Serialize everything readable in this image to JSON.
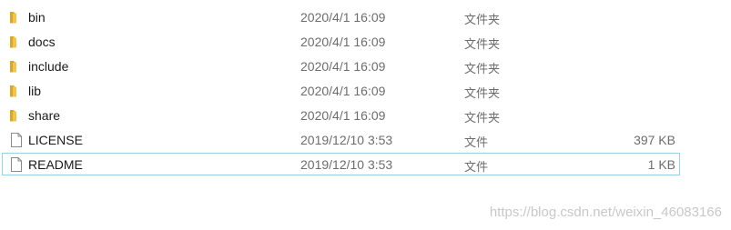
{
  "files": [
    {
      "name": "bin",
      "date": "2020/4/1 16:09",
      "type": "文件夹",
      "size": "",
      "icon": "folder-icon"
    },
    {
      "name": "docs",
      "date": "2020/4/1 16:09",
      "type": "文件夹",
      "size": "",
      "icon": "folder-icon"
    },
    {
      "name": "include",
      "date": "2020/4/1 16:09",
      "type": "文件夹",
      "size": "",
      "icon": "folder-icon"
    },
    {
      "name": "lib",
      "date": "2020/4/1 16:09",
      "type": "文件夹",
      "size": "",
      "icon": "folder-icon"
    },
    {
      "name": "share",
      "date": "2020/4/1 16:09",
      "type": "文件夹",
      "size": "",
      "icon": "folder-icon"
    },
    {
      "name": "LICENSE",
      "date": "2019/12/10 3:53",
      "type": "文件",
      "size": "397 KB",
      "icon": "file-icon"
    },
    {
      "name": "README",
      "date": "2019/12/10 3:53",
      "type": "文件",
      "size": "1 KB",
      "icon": "file-icon"
    }
  ],
  "watermark": "https://blog.csdn.net/weixin_46083166",
  "colors": {
    "folder": "#f3c44d",
    "folder_dark": "#dca729",
    "selection_border": "#99d1ea",
    "secondary_text": "#6d6d6d"
  }
}
